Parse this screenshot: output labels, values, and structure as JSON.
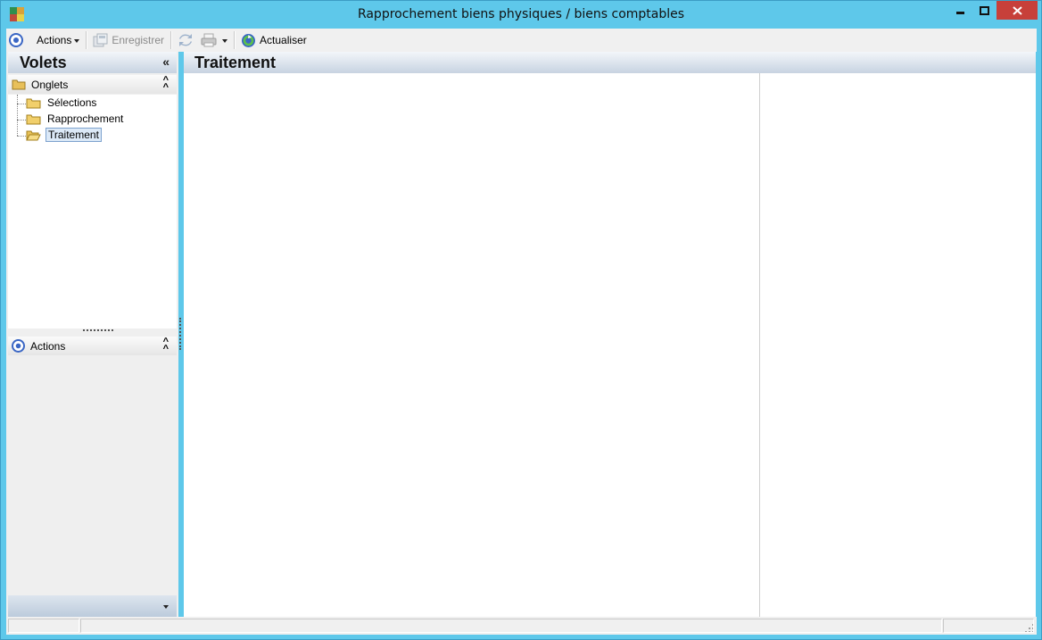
{
  "window": {
    "title": "Rapprochement biens physiques / biens comptables",
    "controls": [
      "minimize-icon",
      "maximize-icon",
      "close-icon"
    ]
  },
  "toolbar": {
    "actions_label": "Actions",
    "save_label": "Enregistrer",
    "refresh_label": "Actualiser"
  },
  "left_panel": {
    "title": "Volets",
    "collapse_glyph": "«",
    "onglets_section": {
      "label": "Onglets",
      "items": [
        {
          "label": "Sélections",
          "selected": false
        },
        {
          "label": "Rapprochement",
          "selected": false
        },
        {
          "label": "Traitement",
          "selected": true
        }
      ]
    },
    "actions_section": {
      "label": "Actions"
    }
  },
  "main_panel": {
    "title": "Traitement"
  },
  "colors": {
    "titlebar": "#5ec8ea",
    "close_button": "#c7403a",
    "header_gradient_top": "#f3f6fa",
    "header_gradient_bottom": "#c7d3e1",
    "selection": "#dce9f7"
  }
}
